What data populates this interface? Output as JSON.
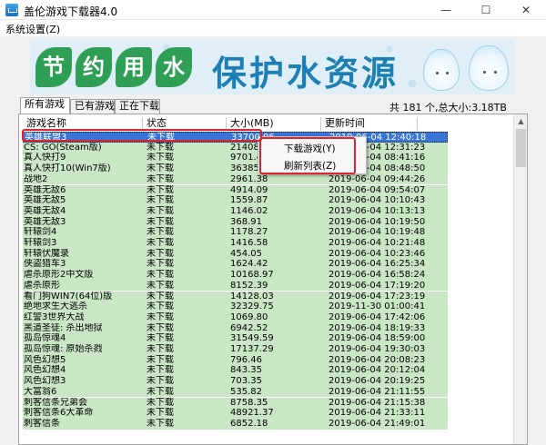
{
  "window": {
    "title": "盖伦游戏下载器4.0",
    "minimize_glyph": "—",
    "maximize_glyph": "☐",
    "close_glyph": "✕"
  },
  "menu": {
    "items": [
      {
        "label": "系统设置(Z)"
      }
    ]
  },
  "banner": {
    "leaf_chars": [
      "节",
      "约",
      "用",
      "水"
    ],
    "slogan": "保护水资源",
    "colors": {
      "leaf": "#2f9f56",
      "slogan": "#1e7fb5"
    }
  },
  "tabs": [
    {
      "label": "所有游戏",
      "active": true
    },
    {
      "label": "已有游戏",
      "active": false
    },
    {
      "label": "正在下载",
      "active": false
    }
  ],
  "summary": "共 181 个,总大小:3.18TB",
  "table": {
    "columns": [
      "游戏名称",
      "状态",
      "大小(MB)",
      "更新时间"
    ],
    "rows": [
      {
        "name": "英雄联盟3",
        "status": "未下载",
        "size": "33700.06",
        "updated": "2019-06-04 12:40:18",
        "selected": true
      },
      {
        "name": "CS: GO(Steam版)",
        "status": "未下载",
        "size": "21408.",
        "updated": "2019-06-04 12:31:23"
      },
      {
        "name": "真人快打9",
        "status": "未下载",
        "size": "9701.4",
        "updated": "2019-06-04 08:41:16"
      },
      {
        "name": "真人快打10(Win7版)",
        "status": "未下载",
        "size": "36385.",
        "updated": "2019-06-04 08:48:50"
      },
      {
        "name": "战地2",
        "status": "未下载",
        "size": "2961.38",
        "updated": "2019-06-04 09:44:26"
      },
      {
        "name": "英雄无敌6",
        "status": "未下载",
        "size": "4914.09",
        "updated": "2019-06-04 09:54:07"
      },
      {
        "name": "英雄无敌5",
        "status": "未下载",
        "size": "1559.87",
        "updated": "2019-06-04 10:10:43"
      },
      {
        "name": "英雄无敌4",
        "status": "未下载",
        "size": "1146.02",
        "updated": "2019-06-04 10:13:13"
      },
      {
        "name": "英雄无敌3",
        "status": "未下载",
        "size": "368.91",
        "updated": "2019-06-04 10:19:50"
      },
      {
        "name": "轩辕剑4",
        "status": "未下载",
        "size": "1178.27",
        "updated": "2019-06-04 10:19:48"
      },
      {
        "name": "轩辕剑3",
        "status": "未下载",
        "size": "1416.58",
        "updated": "2019-06-04 10:21:48"
      },
      {
        "name": "轩辕伏魔录",
        "status": "未下载",
        "size": "454.05",
        "updated": "2019-06-04 10:23:46"
      },
      {
        "name": "侠盗猎车3",
        "status": "未下载",
        "size": "1624.42",
        "updated": "2019-06-04 16:25:34"
      },
      {
        "name": "虐杀原形2中文版",
        "status": "未下载",
        "size": "10168.97",
        "updated": "2019-06-04 16:58:24"
      },
      {
        "name": "虐杀原形",
        "status": "未下载",
        "size": "8152.39",
        "updated": "2019-06-04 17:19:20"
      },
      {
        "name": "看门狗WIN7(64位)版",
        "status": "未下载",
        "size": "14128.03",
        "updated": "2019-06-04 17:23:19"
      },
      {
        "name": "绝地求生大逃杀",
        "status": "未下载",
        "size": "32329.75",
        "updated": "2019-11-30 01:00:41"
      },
      {
        "name": "红警3世界大战",
        "status": "未下载",
        "size": "1069.80",
        "updated": "2019-06-04 17:42:06"
      },
      {
        "name": "黑道圣徒: 杀出地狱",
        "status": "未下载",
        "size": "6942.52",
        "updated": "2019-06-04 18:19:33"
      },
      {
        "name": "孤岛惊魂4",
        "status": "未下载",
        "size": "31549.59",
        "updated": "2019-06-04 18:59:00"
      },
      {
        "name": "孤岛惊魂: 原始杀戮",
        "status": "未下载",
        "size": "17137.29",
        "updated": "2019-06-04 19:30:03"
      },
      {
        "name": "风色幻想5",
        "status": "未下载",
        "size": "796.46",
        "updated": "2019-06-04 20:08:23"
      },
      {
        "name": "风色幻想4",
        "status": "未下载",
        "size": "843.35",
        "updated": "2019-06-04 20:12:04"
      },
      {
        "name": "风色幻想3",
        "status": "未下载",
        "size": "703.35",
        "updated": "2019-06-04 20:19:25"
      },
      {
        "name": "大富翁6",
        "status": "未下载",
        "size": "535.82",
        "updated": "2019-06-04 21:11:55"
      },
      {
        "name": "刺客信条兄弟会",
        "status": "未下载",
        "size": "8758.35",
        "updated": "2019-06-04 21:15:38"
      },
      {
        "name": "刺客信条6大革命",
        "status": "未下载",
        "size": "48921.37",
        "updated": "2019-06-04 21:33:11"
      },
      {
        "name": "刺客信条",
        "status": "未下载",
        "size": "6852.18",
        "updated": "2019-06-04 21:49:01"
      }
    ],
    "row_color": "#c9e7c4",
    "selected_color": "#3875d7"
  },
  "scrollbar": {
    "up_arrow": "▲"
  },
  "context_menu": {
    "download": "下载游戏(Y)",
    "refresh": "刷新列表(Z)"
  },
  "highlight_color": "#e0242b"
}
